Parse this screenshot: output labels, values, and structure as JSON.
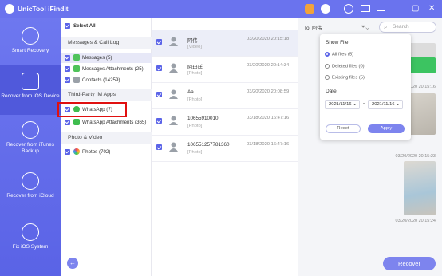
{
  "titlebar": {
    "title": "UnicTool iFindit"
  },
  "sidebar": {
    "items": [
      {
        "label": "Smart Recovery"
      },
      {
        "label": "Recover from iOS Device"
      },
      {
        "label": "Recover from iTunes Backup"
      },
      {
        "label": "Recover from iCloud"
      },
      {
        "label": "Fix iOS System"
      }
    ]
  },
  "categories": {
    "select_all": "Select All",
    "group1": "Messages & Call Log",
    "messages": "Messages (5)",
    "messages_attachments": "Messages Attachments (25)",
    "contacts": "Contacts (14259)",
    "group2": "Third-Party IM Apps",
    "whatsapp": "WhatsApp (7)",
    "whatsapp_attachments": "WhatsApp Attachments (365)",
    "group3": "Photo & Video",
    "photos": "Photos (702)"
  },
  "messages": [
    {
      "name": "阿伟",
      "sub": "[Video]",
      "time": "03/20/2020 20:15:18"
    },
    {
      "name": "阿玛廷",
      "sub": "[Photo]",
      "time": "03/20/2020 20:14:34"
    },
    {
      "name": "Aa",
      "sub": "[Photo]",
      "time": "03/20/2020 20:08:59"
    },
    {
      "name": "10655910010",
      "sub": "[Photo]",
      "time": "03/18/2020 16:47:16"
    },
    {
      "name": "106551257781360",
      "sub": "[Photo]",
      "time": "03/18/2020 16:47:16"
    }
  ],
  "detail": {
    "to": "To: 阿伟",
    "timestamps": [
      "03/20/2020 20:15:16",
      "03/20/2020 20:15:23",
      "03/20/2020 20:15:24"
    ]
  },
  "search": {
    "placeholder": "Search"
  },
  "filter": {
    "show_file": "Show File",
    "all_files": "All files (5)",
    "deleted_files": "Deleted files (0)",
    "existing_files": "Existing files (5)",
    "date": "Date",
    "date_from": "2021/11/16",
    "date_sep": "-",
    "date_to": "2021/11/16",
    "reset": "Reset",
    "apply": "Apply"
  },
  "footer": {
    "recover": "Recover",
    "back": "←"
  },
  "colors": {
    "accent": "#5b64e8",
    "sidebar": "#6a73ee",
    "highlight": "#e01010"
  }
}
